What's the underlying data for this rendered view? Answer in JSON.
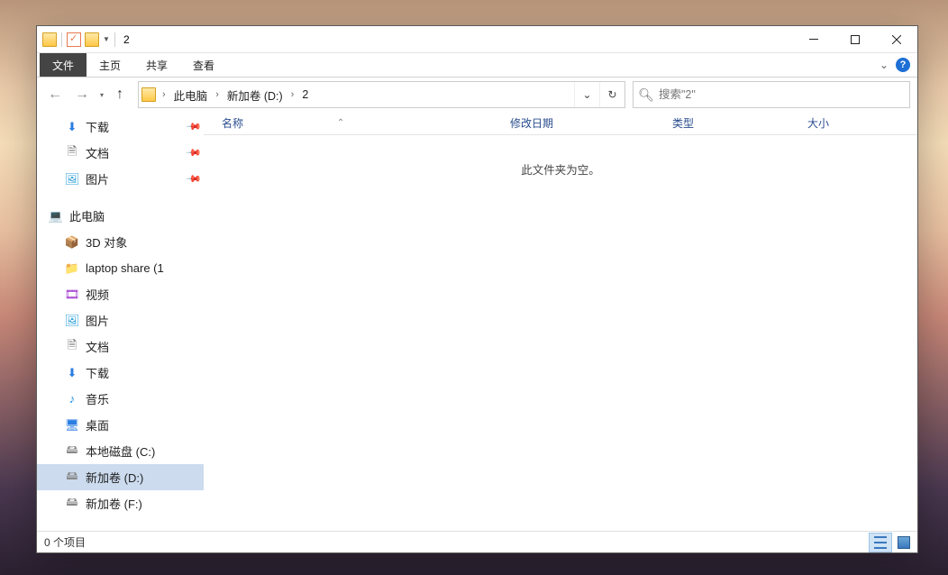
{
  "title": "2",
  "ribbon": {
    "file": "文件",
    "home": "主页",
    "share": "共享",
    "view": "查看"
  },
  "breadcrumb": {
    "seg1": "此电脑",
    "seg2": "新加卷 (D:)",
    "seg3": "2"
  },
  "search": {
    "placeholder": "搜索\"2\""
  },
  "columns": {
    "name": "名称",
    "date": "修改日期",
    "type": "类型",
    "size": "大小"
  },
  "empty_msg": "此文件夹为空。",
  "status": "0 个项目",
  "sidebar": {
    "downloads": "下载",
    "documents": "文档",
    "pictures": "图片",
    "thispc": "此电脑",
    "obj3d": "3D 对象",
    "laptop": "laptop share (1",
    "videos": "视频",
    "pictures2": "图片",
    "documents2": "文档",
    "downloads2": "下载",
    "music": "音乐",
    "desktop": "桌面",
    "diskC": "本地磁盘 (C:)",
    "diskD": "新加卷 (D:)",
    "diskE": "新加卷 (F:)"
  }
}
